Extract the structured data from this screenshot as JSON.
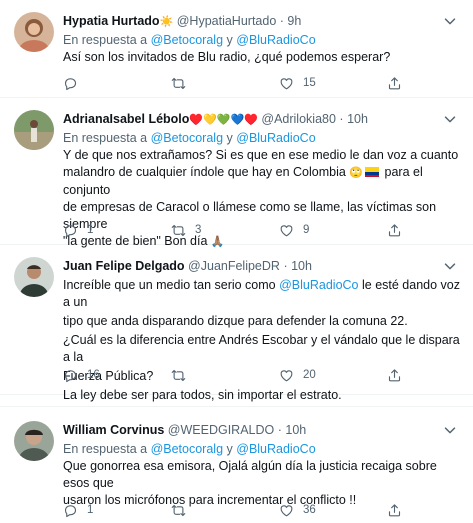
{
  "tweets": [
    {
      "name": "Hypatia Hurtado",
      "name_emoji": "☀️",
      "handle": "@HypatiaHurtado",
      "sep": "·",
      "time": "9h",
      "reply_prefix": "En respuesta a",
      "reply_to_1": "@Betocoralg",
      "reply_and": "y",
      "reply_to_2": "@BluRadioCo",
      "text": "Así son los invitados de Blu radio,  ¿qué podemos esperar?",
      "replies": "",
      "retweets": "",
      "likes": "15"
    },
    {
      "name": "AdrianaIsabel Lébolo",
      "name_emojis": "♥️💛💚💙♥️",
      "handle": "@Adrilokia80",
      "sep": "·",
      "time": "10h",
      "reply_prefix": "En respuesta a",
      "reply_to_1": "@Betocoralg",
      "reply_and": "y",
      "reply_to_2": "@BluRadioCo",
      "text_line1": "Y de que nos extrañamos? Si es que en ese medio le dan voz a cuanto",
      "text_line2a": "malandro de cualquier índole que hay en Colombia",
      "text_emoji": "🙄",
      "text_line2b": "para el conjunto",
      "text_line3": "de empresas de Caracol o llámese como se llame, las víctimas son siempre",
      "text_line4": "\"la gente de bien\" Bon día",
      "text_line4_emoji": "🙏🏽",
      "replies": "1",
      "retweets": "3",
      "likes": "9"
    },
    {
      "name": "Juan Felipe Delgado",
      "handle": "@JuanFelipeDR",
      "sep": "·",
      "time": "10h",
      "text_line1a": "Increíble que un medio tan serio como",
      "text_mention": "@BluRadioCo",
      "text_line1b": "le esté dando voz a un",
      "text_line2": "tipo que anda disparando dizque para defender la comuna 22.",
      "text_line3": "¿Cuál es la diferencia entre Andrés Escobar y el vándalo que le dispara a la",
      "text_line4": "Fuerza Pública?",
      "text_line5": "La ley debe ser para todos, sin importar el estrato.",
      "replies": "16",
      "retweets": "",
      "likes": "20"
    },
    {
      "name": "William Corvinus",
      "handle": "@WEEDGIRALDO",
      "sep": "·",
      "time": "10h",
      "reply_prefix": "En respuesta a",
      "reply_to_1": "@Betocoralg",
      "reply_and": "y",
      "reply_to_2": "@BluRadioCo",
      "text_line1": "Que gonorrea esa emisora, Ojalá algún día la justicia recaiga sobre esos que",
      "text_line2": "usaron los micrófonos para incrementar el conflicto !!",
      "replies": "1",
      "retweets": "",
      "likes": "36"
    }
  ],
  "colors": {
    "link": "#1b95e0",
    "secondary": "#536471",
    "text": "#0f1419",
    "divider": "#eff3f4"
  },
  "icons": [
    "avatar",
    "more-icon",
    "reply-icon",
    "retweet-icon",
    "like-icon",
    "share-icon",
    "colombia-flag-icon"
  ]
}
